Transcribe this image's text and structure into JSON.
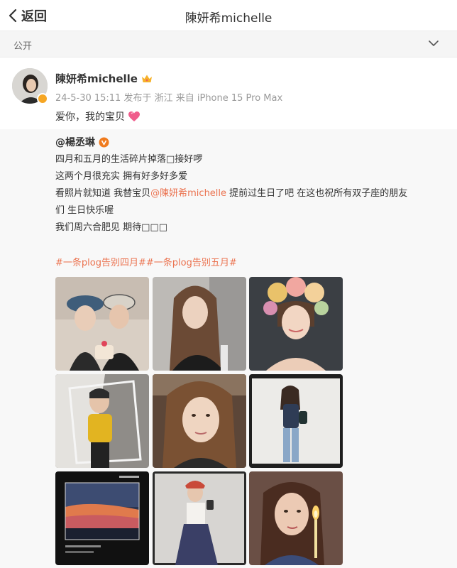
{
  "topbar": {
    "back_label": "返回",
    "title": "陳妍希michelle"
  },
  "visibility": {
    "label": "公开"
  },
  "post": {
    "author": "陳妍希michelle",
    "meta": "24-5-30 15:11 发布于 浙江 来自 iPhone 15 Pro Max",
    "content": "爱你，我的宝贝"
  },
  "repost": {
    "author": "@楊丞琳",
    "line1": "四月和五月的生活碎片掉落□接好啰",
    "line2": "这两个月很充实 拥有好多好多爱",
    "line3_a": "看照片就知道 我替宝贝",
    "line3_mention": "@陳妍希michelle",
    "line3_b": " 提前过生日了吧 在这也祝所有双子座的朋友",
    "line4": "们 生日快乐喔",
    "line5": "我们周六合肥见 期待□□□",
    "tags": "#一条plog告别四月##一条plog告别五月#"
  },
  "photos": [
    "photo-two-women-bucket-hats-cake",
    "photo-woman-long-hair-selfie",
    "photo-woman-flower-crown",
    "photo-woman-yellow-top-mirror",
    "photo-woman-closeup-portrait",
    "photo-woman-denim-white-room",
    "photo-sunset-window-style",
    "photo-woman-mirror-selfie-dress",
    "photo-woman-birthday-candle"
  ],
  "colors": {
    "accent": "#eb7350",
    "badge": "#f6a623",
    "heart": "#f05d8c"
  }
}
